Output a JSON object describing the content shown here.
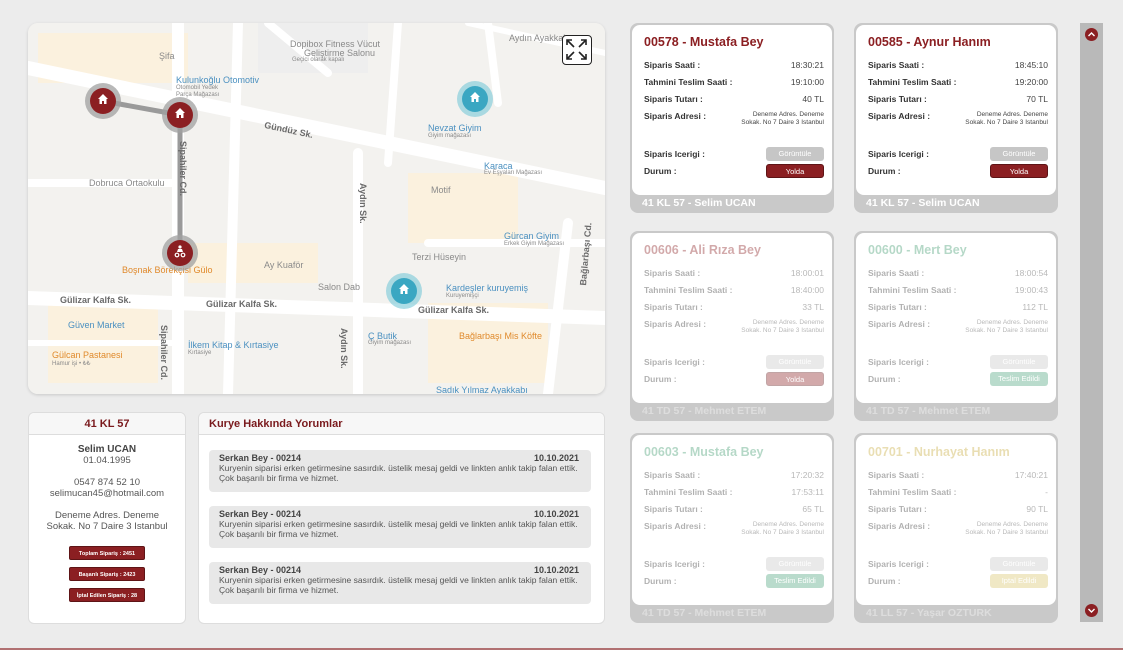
{
  "map": {
    "streets": [
      "Gündüz Sk.",
      "Sipahiler Cd.",
      "Sipahiler Cd.",
      "Aydın Sk.",
      "Aydın Sk.",
      "Gülizar Kalfa Sk.",
      "Gülizar Kalfa Sk.",
      "Gülizar Kalfa Sk.",
      "Bağlarbaşı Cd."
    ],
    "places": [
      "Şifa",
      "Dopibox Fitness Vücut",
      "Geliştirme Salonu",
      "Geçici olarak kapalı",
      "Aydın Ayakkabı",
      "Kulunkoğlu Otomotiv",
      "Otomobil Yedek",
      "Parça Mağazası",
      "Nevzat Giyim",
      "Giyim mağazası",
      "Karaca",
      "Ev Eşyaları Mağazası",
      "Dobruca Ortaokulu",
      "Motif",
      "Gürcan Giyim",
      "Erkek Giyim Mağazası",
      "Terzi Hüseyin",
      "Ay Kuaför",
      "Boşnak Börekçisi Gülo",
      "Salon Dab",
      "Kardeşler kuruyemiş",
      "Kuruyemişçi",
      "Güven Market",
      "Ç Butik",
      "Giyim mağazası",
      "Bağlarbaşı Mis Köfte",
      "İlkem Kitap & Kırtasiye",
      "Kırtasiye",
      "Gülcan Pastanesi",
      "Hamur işi • ₺₺",
      "Sadık Yılmaz Ayakkabı"
    ]
  },
  "courier": {
    "plate": "41 KL 57",
    "name": "Selim UCAN",
    "birth": "01.04.1995",
    "phone": "0547 874 52 10",
    "email": "selimucan45@hotmail.com",
    "address_line1": "Deneme Adres. Deneme",
    "address_line2": "Sokak. No 7 Daire 3 Istanbul",
    "stats": [
      "Toplam Sipariş : 2451",
      "Başarılı Sipariş : 2423",
      "İptal Edilen Sipariş : 28"
    ]
  },
  "comments": {
    "title": "Kurye Hakkında Yorumlar",
    "items": [
      {
        "author": "Serkan Bey - 00214",
        "date": "10.10.2021",
        "text": "Kuryenin siparisi erken getirmesine sasırdık. üstelik mesaj geldi ve linkten anlık takip falan ettik.  Çok başarılı bir firma ve hizmet."
      },
      {
        "author": "Serkan Bey - 00214",
        "date": "10.10.2021",
        "text": "Kuryenin siparisi erken getirmesine sasırdık. üstelik mesaj geldi ve linkten anlık takip falan ettik.  Çok başarılı bir firma ve hizmet."
      },
      {
        "author": "Serkan Bey - 00214",
        "date": "10.10.2021",
        "text": "Kuryenin siparisi erken getirmesine sasırdık. üstelik mesaj geldi ve linkten anlık takip falan ettik.  Çok başarılı bir firma ve hizmet."
      }
    ]
  },
  "labels": {
    "order_time": "Siparis Saati :",
    "eta": "Tahmini Teslim Saati :",
    "amount": "Siparis Tutarı :",
    "address": "Siparis Adresi :",
    "content": "Siparis Icerigi :",
    "status": "Durum :",
    "view": "Görüntüle"
  },
  "orders": [
    {
      "title": "00578 - Mustafa Bey",
      "time": "18:30:21",
      "eta": "19:10:00",
      "amount": "40 TL",
      "address": "Deneme Adres. Deneme Sokak. No 7 Daire 3 Istanbul",
      "status": "Yolda",
      "courier": "41 KL 57 - Selim UCAN"
    },
    {
      "title": "00585 - Aynur Hanım",
      "time": "18:45:10",
      "eta": "19:20:00",
      "amount": "70 TL",
      "address": "Deneme Adres. Deneme Sokak. No 7 Daire 3 Istanbul",
      "status": "Yolda",
      "courier": "41 KL 57 - Selim UCAN"
    },
    {
      "title": "00606 - Ali Rıza Bey",
      "time": "18:00:01",
      "eta": "18:40:00",
      "amount": "33 TL",
      "address": "Deneme Adres. Deneme Sokak. No 7 Daire 3 Istanbul",
      "status": "Yolda",
      "courier": "41 TD 57 - Mehmet ETEM"
    },
    {
      "title": "00600 - Mert Bey",
      "time": "18:00:54",
      "eta": "19:00:43",
      "amount": "112 TL",
      "address": "Deneme Adres. Deneme Sokak. No 7 Daire 3 Istanbul",
      "status": "Teslim Edildi",
      "courier": "41 TD 57 - Mehmet ETEM"
    },
    {
      "title": "00603 - Mustafa Bey",
      "time": "17:20:32",
      "eta": "17:53:11",
      "amount": "65 TL",
      "address": "Deneme Adres. Deneme Sokak. No 7 Daire 3 Istanbul",
      "status": "Teslim Edildi",
      "courier": "41 TD 57 - Mehmet ETEM"
    },
    {
      "title": "00701 - Nurhayat Hanım",
      "time": "17:40:21",
      "eta": "-",
      "amount": "90 TL",
      "address": "Deneme Adres. Deneme Sokak. No 7 Daire 3 Istanbul",
      "status": "Iptal Edildi",
      "courier": "41 LL 57 - Yaşar OZTURK"
    }
  ],
  "colors": {
    "brand": "#8b1f22",
    "delivered": "#4aa37a",
    "cancelled": "#d8c46a",
    "map_pin": "#3aa7c2"
  },
  "icons": [
    "expand-icon",
    "home-icon",
    "motorcycle-courier-icon",
    "chevron-up-icon",
    "chevron-down-icon"
  ]
}
